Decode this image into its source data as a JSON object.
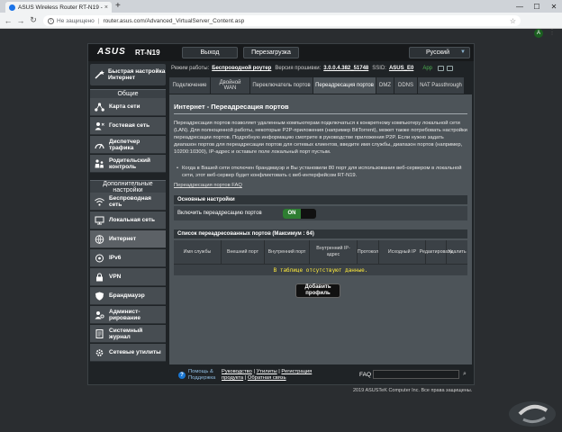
{
  "browser": {
    "tab_title": "ASUS Wireless Router RT-N19 - Пер",
    "tab_close": "×",
    "new_tab": "+",
    "minimize": "—",
    "maximize": "☐",
    "close": "✕",
    "security": "Не защищено",
    "separator": "|",
    "url": "router.asus.com/Advanced_VirtualServer_Content.asp",
    "avatar_letter": "A"
  },
  "router": {
    "logo": "ASUS",
    "model": "RT-N19",
    "logout": "Выход",
    "reboot": "Перезагрузка",
    "language": "Русский",
    "status": {
      "mode_label": "Режим работы:",
      "mode_value": "Беспроводной роутер",
      "fw_label": "Версия прошивки:",
      "fw_value": "3.0.0.4.382_51748",
      "ssid_label": "SSID:",
      "ssid_value": "ASUS_E0",
      "app": "App"
    }
  },
  "sidebar": {
    "quick_setup": "Быстрая настройка Интернет",
    "general_header": "Общие",
    "general": [
      {
        "label": "Карта сети"
      },
      {
        "label": "Гостевая сеть"
      },
      {
        "label": "Диспетчер трафика"
      },
      {
        "label": "Родительский контроль"
      }
    ],
    "advanced_header": "Дополнительные настройки",
    "advanced": [
      {
        "label": "Беспроводная сеть"
      },
      {
        "label": "Локальная сеть"
      },
      {
        "label": "Интернет"
      },
      {
        "label": "IPv6"
      },
      {
        "label": "VPN"
      },
      {
        "label": "Брандмауэр"
      },
      {
        "label": "Админист-рирование"
      },
      {
        "label": "Системный журнал"
      },
      {
        "label": "Сетевые утилиты"
      }
    ]
  },
  "tabs": [
    {
      "label": "Подключение"
    },
    {
      "label": "Двойной WAN"
    },
    {
      "label": "Переключатель портов"
    },
    {
      "label": "Переадресация портов"
    },
    {
      "label": "DMZ"
    },
    {
      "label": "DDNS"
    },
    {
      "label": "NAT Passthrough"
    }
  ],
  "content": {
    "title": "Интернет - Переадресация портов",
    "description": "Переадресация портов позволяет удаленным компьютерам подключаться к конкретному компьютеру локальной сети (LAN). Для полноценной работы, некоторые P2P-приложения (например BitTorrent), может также потребовать настройки переадресации портов. Подробную информацию смотрите в руководстве приложения P2P. Если нужно задать диапазон портов для переадресации портов для сетевых клиентов, введите имя службы, диапазон портов (например, 10200:10300), IP-адрес и оставьте поле локальный порт пустым.",
    "bullet": "Когда в Вашей сети отключен брандмауэр и Вы установили 80 порт для использования веб-сервером в локальной сети, этот веб-сервер будет конфликтовать с веб-интерфейсом RT-N19.",
    "faq_link": "Переадресация портов FAQ",
    "basic_header": "Основные настройки",
    "enable_label": "Включить переадресацию портов",
    "toggle_on": "ON",
    "list_header": "Список переадресованных портов (Максимум : 64)",
    "columns": [
      "Имя службы",
      "Внешний порт",
      "Внутренний порт",
      "Внутренний IP-адрес",
      "Протокол",
      "Исходный IP",
      "Редактировать",
      "Удалить"
    ],
    "empty": "В таблице отсутствуют данные.",
    "add_profile": "Добавить профиль"
  },
  "footer": {
    "help_line1": "Помощь &",
    "help_line2": "Поддержка",
    "links_line1a": "Руководство",
    "links_line1b": "Утилиты",
    "links_line1c": "Регистрация",
    "links_line2a": "продукта",
    "links_line2b": "Обратная связь",
    "faq": "FAQ",
    "copyright": "2019 ASUSTeK Computer Inc. Все права защищены."
  }
}
